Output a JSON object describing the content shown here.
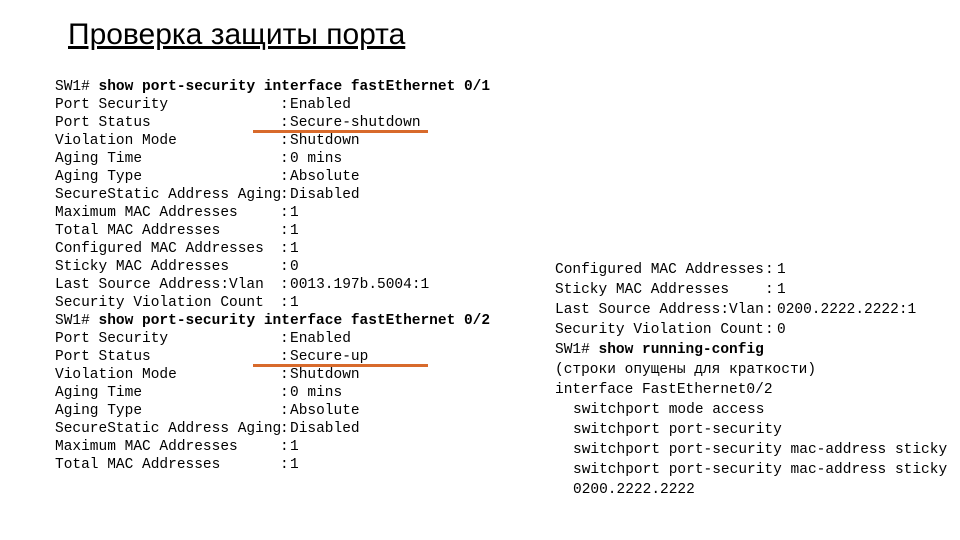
{
  "title": "Проверка защиты порта",
  "left": {
    "cmd1": {
      "prompt": "SW1# ",
      "cmd": "show port-security interface fastEthernet 0/1"
    },
    "sec1": [
      {
        "label": "Port Security",
        "value": "Enabled"
      },
      {
        "label": "Port Status",
        "value": "Secure-shutdown"
      },
      {
        "label": "Violation Mode",
        "value": "Shutdown"
      },
      {
        "label": "Aging Time",
        "value": "0 mins"
      },
      {
        "label": "Aging Type",
        "value": "Absolute"
      },
      {
        "label": "SecureStatic Address Aging",
        "value": "Disabled"
      },
      {
        "label": "Maximum MAC Addresses",
        "value": "1"
      },
      {
        "label": "Total MAC Addresses",
        "value": "1"
      },
      {
        "label": "Configured MAC Addresses",
        "value": "1"
      },
      {
        "label": "Sticky MAC Addresses",
        "value": "0"
      },
      {
        "label": "Last Source Address:Vlan",
        "value": "0013.197b.5004:1"
      },
      {
        "label": "Security Violation Count",
        "value": "1"
      }
    ],
    "cmd2": {
      "prompt": "SW1# ",
      "cmd": "show port-security interface fastEthernet 0/2"
    },
    "sec2": [
      {
        "label": "Port Security",
        "value": "Enabled"
      },
      {
        "label": "Port Status",
        "value": "Secure-up"
      },
      {
        "label": "Violation Mode",
        "value": "Shutdown"
      },
      {
        "label": "Aging Time",
        "value": "0 mins"
      },
      {
        "label": "Aging Type",
        "value": "Absolute"
      },
      {
        "label": "SecureStatic Address Aging",
        "value": "Disabled"
      },
      {
        "label": "Maximum MAC Addresses",
        "value": "1"
      },
      {
        "label": "Total MAC Addresses",
        "value": "1"
      }
    ]
  },
  "right": {
    "rows": [
      {
        "label": "Configured MAC Addresses",
        "value": "1"
      },
      {
        "label": "Sticky MAC Addresses",
        "value": "1"
      },
      {
        "label": "Last Source Address:Vlan",
        "value": "0200.2222.2222:1"
      },
      {
        "label": "Security Violation Count",
        "value": "0"
      }
    ],
    "cmd": {
      "prompt": "SW1# ",
      "cmd": "show running-config"
    },
    "comment": "(строки опущены для краткости)",
    "iface": "interface FastEthernet0/2",
    "cfg": [
      "switchport mode access",
      "switchport port-security",
      "switchport port-security mac-address sticky",
      "switchport port-security mac-address sticky 0200.2222.2222"
    ]
  }
}
